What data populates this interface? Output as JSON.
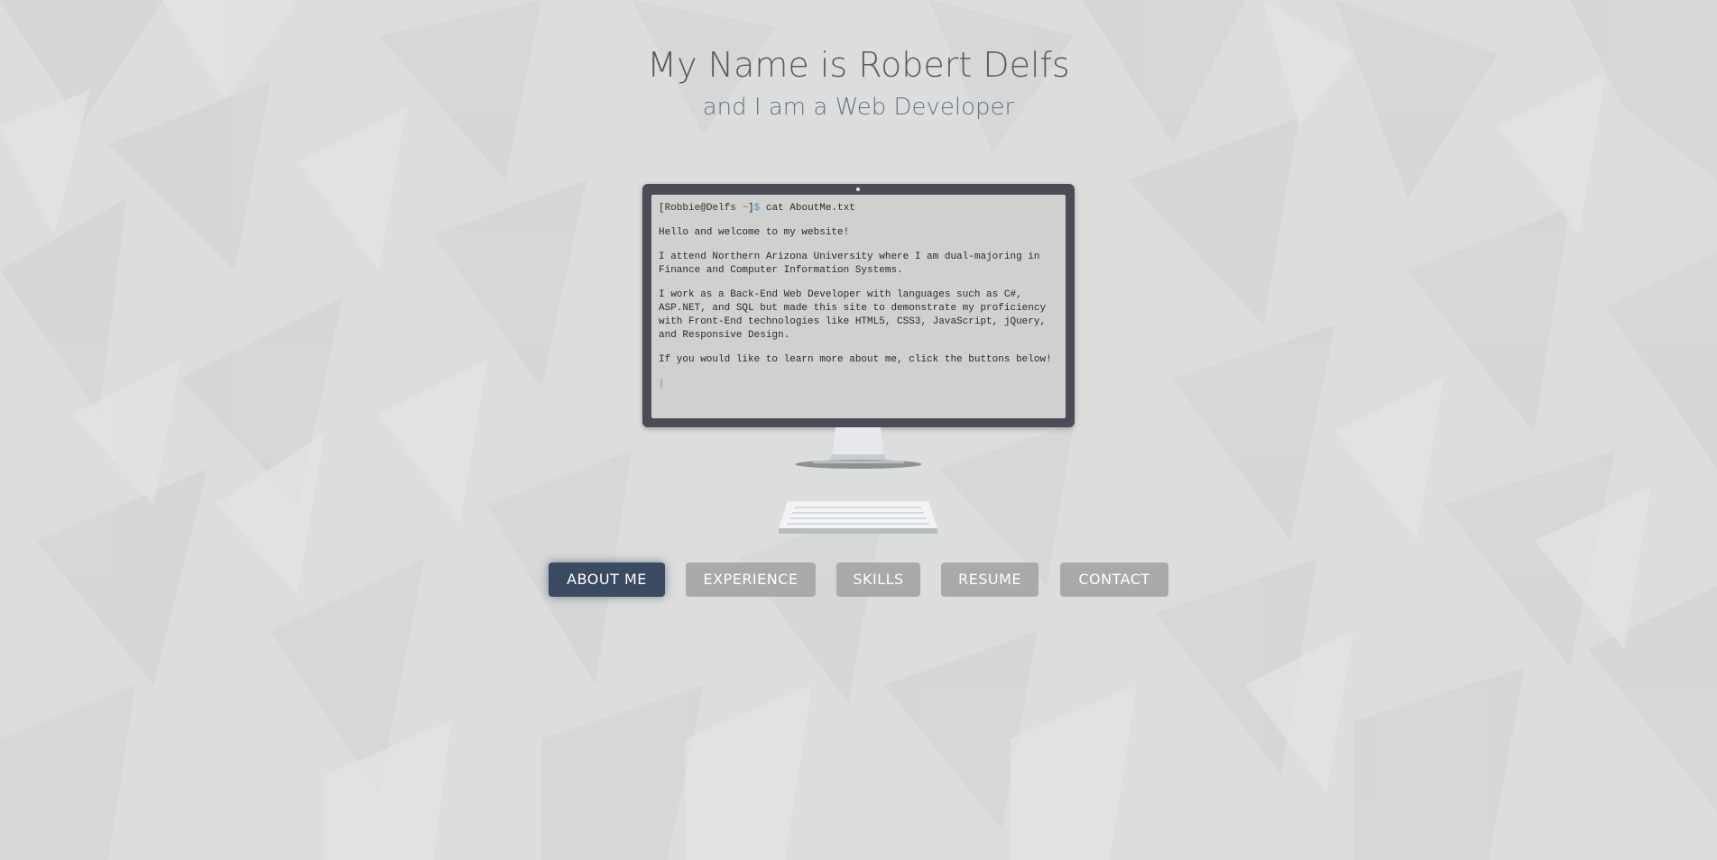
{
  "header": {
    "title": "My Name is Robert Delfs",
    "subtitle": "and I am a Web Developer"
  },
  "terminal": {
    "prompt_open": "[",
    "prompt_user": "Robbie@Delfs",
    "prompt_tilde": "~",
    "prompt_close": "]",
    "prompt_symbol": "$",
    "command": "cat AboutMe.txt",
    "paragraphs": [
      "Hello and welcome to my website!",
      "I attend Northern Arizona University where I am dual-majoring in Finance and Computer Information Systems.",
      "I work as a Back-End Web Developer with languages such as C#, ASP.NET, and SQL but made this site to demonstrate my proficiency with Front-End technologies like HTML5, CSS3, JavaScript, jQuery, and Responsive Design.",
      "If you would like to learn more about me, click the buttons below!"
    ],
    "cursor": "|"
  },
  "nav": {
    "buttons": [
      {
        "label": "ABOUT ME",
        "active": true
      },
      {
        "label": "EXPERIENCE",
        "active": false
      },
      {
        "label": "SKILLS",
        "active": false
      },
      {
        "label": "RESUME",
        "active": false
      },
      {
        "label": "CONTACT",
        "active": false
      }
    ]
  },
  "colors": {
    "background": "#dcdddd",
    "active_button": "#3a4a60",
    "inactive_button": "#a9a9a9",
    "monitor_frame": "#4b4c57",
    "screen": "#d0d0d0",
    "tilde": "#d9386b",
    "dollar": "#3aa0c8"
  }
}
